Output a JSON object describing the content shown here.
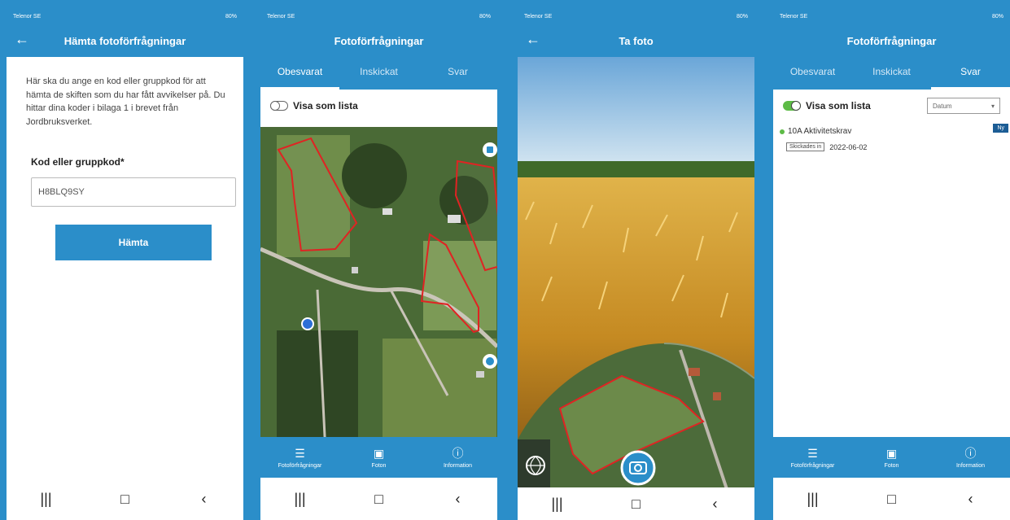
{
  "system": {
    "carrier": "Telenor SE",
    "battery": "80%"
  },
  "android_nav": {
    "recent_icon": "|||",
    "home_icon": "□",
    "back_icon": "‹"
  },
  "back_arrow": "←",
  "panel1": {
    "title": "Hämta fotoförfrågningar",
    "instructions": "Här ska du ange en kod eller gruppkod för att hämta de skiften som du har fått avvikelser på. Du hittar dina koder i bilaga 1 i brevet från Jordbruksverket.",
    "field_label": "Kod eller gruppkod*",
    "field_value": "H8BLQ9SY",
    "button_label": "Hämta"
  },
  "panel2": {
    "title": "Fotoförfrågningar",
    "tabs": [
      "Obesvarat",
      "Inskickat",
      "Svar"
    ],
    "active_tab": 0,
    "toggle_label": "Visa som lista",
    "toggle_on": false
  },
  "bottom_tabs": [
    {
      "label": "Fotoförfrågningar",
      "icon": "list-icon",
      "glyph": "☰"
    },
    {
      "label": "Foton",
      "icon": "image-icon",
      "glyph": "▣"
    },
    {
      "label": "Information",
      "icon": "info-icon",
      "glyph": "ⓘ"
    }
  ],
  "panel3": {
    "title": "Ta foto",
    "globe_icon": "globe-icon",
    "camera_icon": "camera-icon"
  },
  "panel4": {
    "title": "Fotoförfrågningar",
    "tabs": [
      "Obesvarat",
      "Inskickat",
      "Svar"
    ],
    "active_tab": 2,
    "toggle_label": "Visa som lista",
    "toggle_on": true,
    "sort_value": "Datum",
    "items": [
      {
        "title": "10A Aktivitetskrav",
        "status": "Skickades in",
        "date": "2022-06-02",
        "badge": "Ny"
      }
    ]
  },
  "colors": {
    "primary": "#2b8ec9",
    "green": "#5dbb46",
    "badge": "#1c5d95",
    "field_outline": "#cc2222"
  }
}
